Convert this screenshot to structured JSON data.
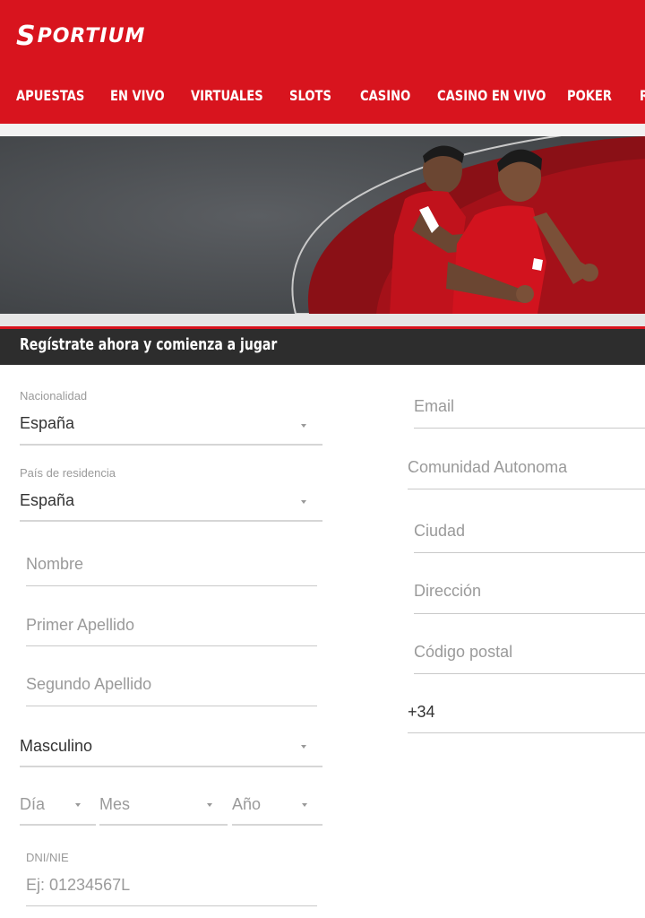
{
  "brand": {
    "logo_text": "PORTIUM",
    "logo_initial": "S"
  },
  "nav": {
    "items": [
      "APUESTAS",
      "EN VIVO",
      "VIRTUALES",
      "SLOTS",
      "CASINO",
      "CASINO EN VIVO",
      "POKER",
      "R"
    ]
  },
  "registration": {
    "title": "Regístrate ahora y comienza a jugar"
  },
  "form": {
    "nationality": {
      "label": "Nacionalidad",
      "value": "España"
    },
    "residence": {
      "label": "País de residencia",
      "value": "España"
    },
    "first_name": {
      "placeholder": "Nombre"
    },
    "last_name_1": {
      "placeholder": "Primer Apellido"
    },
    "last_name_2": {
      "placeholder": "Segundo Apellido"
    },
    "gender": {
      "value": "Masculino"
    },
    "birth_day": {
      "placeholder": "Día"
    },
    "birth_month": {
      "placeholder": "Mes"
    },
    "birth_year": {
      "placeholder": "Año"
    },
    "dni": {
      "label": "DNI/NIE",
      "placeholder": "Ej: 01234567L"
    },
    "email": {
      "placeholder": "Email"
    },
    "region": {
      "placeholder": "Comunidad Autonoma"
    },
    "city": {
      "placeholder": "Ciudad"
    },
    "address": {
      "placeholder": "Dirección"
    },
    "postal_code": {
      "placeholder": "Código postal"
    },
    "phone": {
      "prefix": "+34"
    }
  },
  "colors": {
    "brand_red": "#d8141e",
    "bar_dark": "#2d2d2d"
  }
}
